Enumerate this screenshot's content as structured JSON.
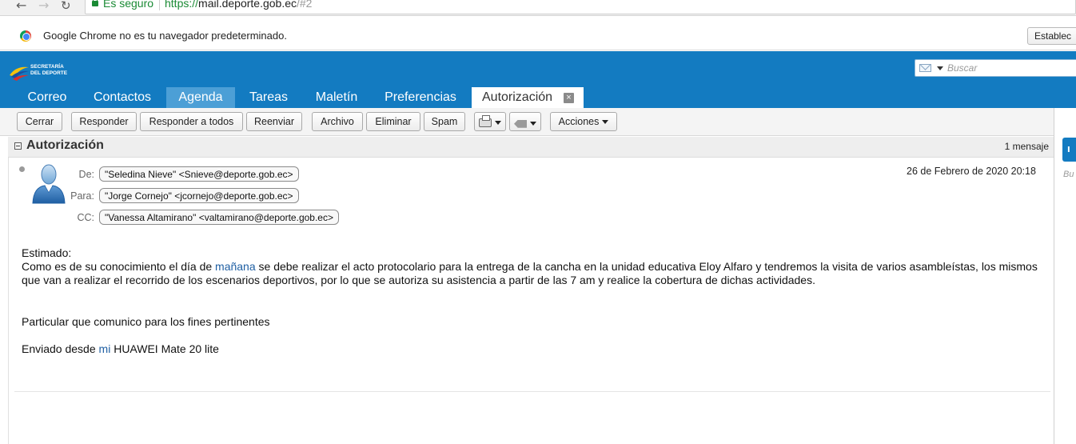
{
  "browser": {
    "secure_label": "Es seguro",
    "url_scheme": "https://",
    "url_host": "mail.deporte.gob.ec",
    "url_hash": "/#2",
    "infobar_text": "Google Chrome no es tu navegador predeterminado.",
    "infobar_button": "Establec"
  },
  "app": {
    "logo_line1": "SECRETARÍA",
    "logo_line2": "DEL DEPORTE",
    "search_placeholder": "Buscar",
    "tabs": [
      "Correo",
      "Contactos",
      "Agenda",
      "Tareas",
      "Maletín",
      "Preferencias",
      "Autorización"
    ],
    "active_tab": "Autorización"
  },
  "toolbar": {
    "cerrar": "Cerrar",
    "responder": "Responder",
    "responder_todos": "Responder a todos",
    "reenviar": "Reenviar",
    "archivo": "Archivo",
    "eliminar": "Eliminar",
    "spam": "Spam",
    "acciones": "Acciones"
  },
  "message": {
    "subject": "Autorización",
    "count": "1 mensaje",
    "from_label": "De:",
    "from": "\"Seledina Nieve\" <Snieve@deporte.gob.ec>",
    "to_label": "Para:",
    "to": "\"Jorge Cornejo\" <jcornejo@deporte.gob.ec>",
    "cc_label": "CC:",
    "cc": "\"Vanessa Altamirano\" <valtamirano@deporte.gob.ec>",
    "date": "26 de Febrero de 2020 20:18",
    "greeting": "Estimado:",
    "para1_a": "Como es de su conocimiento el día de ",
    "para1_link": "mañana",
    "para1_b": " se debe realizar el acto protocolario para la entrega de la cancha en la unidad educativa Eloy Alfaro  y tendremos la visita de varios asambleístas, los mismos que van a realizar el recorrido de los escenarios deportivos, por lo que se autoriza su asistencia a partir de las 7 am y realice la cobertura de dichas actividades.",
    "para2": "Particular que comunico para los fines pertinentes",
    "sig_a": "Enviado desde ",
    "sig_link": "mi",
    "sig_b": " HUAWEI Mate 20 lite"
  },
  "right_panel": {
    "tab_letter": "I",
    "text": "Bu"
  },
  "colors": {
    "header_blue": "#137bc1",
    "active_tab_blue": "#4c9fd6",
    "secure_green": "#1a8a34",
    "link_blue": "#1f5fa3"
  }
}
